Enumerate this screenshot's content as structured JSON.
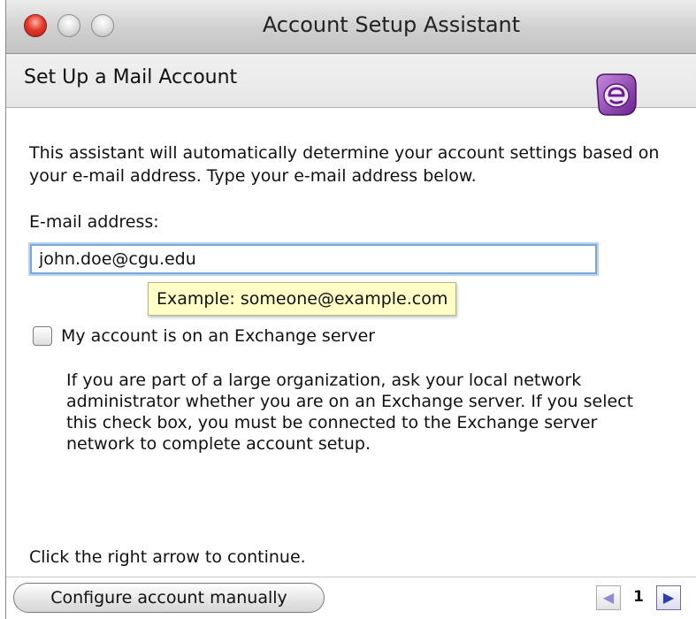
{
  "window": {
    "title": "Account Setup Assistant"
  },
  "header": {
    "title": "Set Up a Mail Account",
    "logo_icon": "entourage-logo-icon"
  },
  "intro_text": "This assistant will automatically determine your account settings based on your e-mail address. Type your e-mail address below.",
  "email": {
    "label": "E-mail address:",
    "value": "john.doe@cgu.edu",
    "tooltip": "Example: someone@example.com"
  },
  "exchange": {
    "checkbox_label": "My account is on an Exchange server",
    "checked": false,
    "note": "If you are part of a large organization, ask your local network\nadministrator whether you are on an Exchange server. If you select\nthis check box, you must be connected to the Exchange server\nnetwork to complete account setup."
  },
  "footer": {
    "continue_hint": "Click the right arrow to continue.",
    "manual_button": "Configure account manually",
    "page_number": "1",
    "prev_icon": "left-arrow-icon",
    "next_icon": "right-arrow-icon"
  },
  "colors": {
    "close_button": "#e33a2c",
    "focus_ring": "#7aa7da",
    "tooltip_bg": "#ffffc6",
    "logo_purple": "#8e3fb0"
  }
}
